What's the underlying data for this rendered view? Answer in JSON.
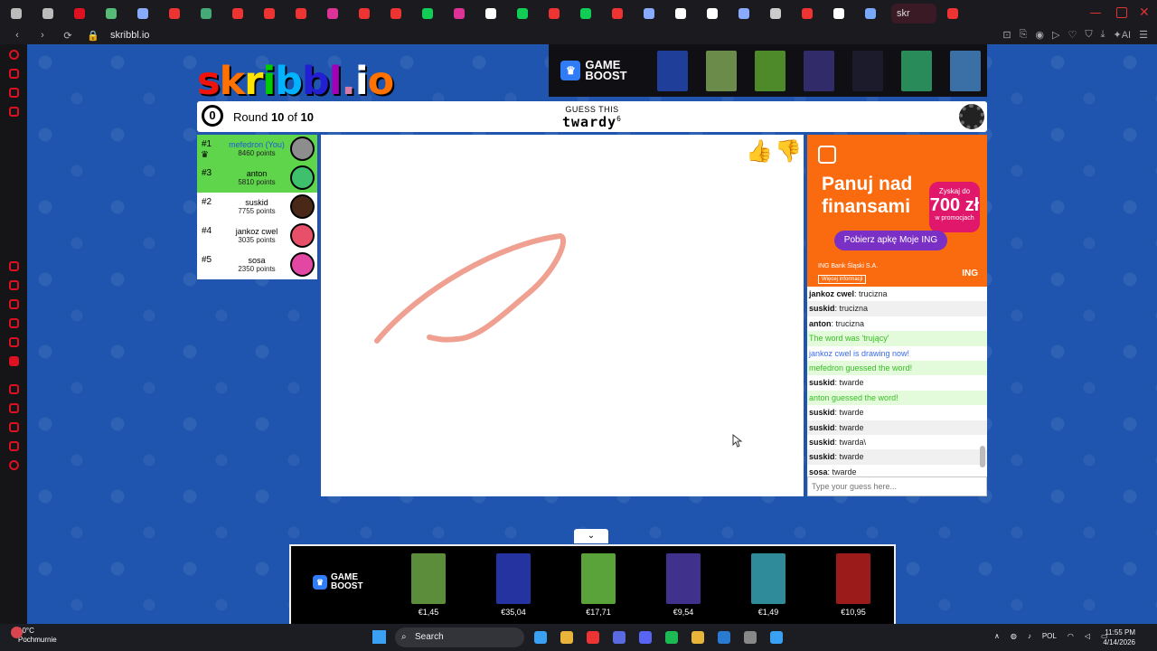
{
  "browser": {
    "url": "skribbl.io",
    "active_tab_label": "skr",
    "tab_icon_colors": [
      "#bbb",
      "#bbb",
      "#d12",
      "#5b7",
      "#8af",
      "#e33",
      "#4a7",
      "#e33",
      "#e33",
      "#e33",
      "#d39",
      "#e33",
      "#e33",
      "#1c5",
      "#d39",
      "#fff",
      "#1c5",
      "#e33",
      "#1c5",
      "#e33",
      "#8af",
      "#fff",
      "#fff",
      "#8af",
      "#ccc",
      "#e33",
      "#fff",
      "#7af",
      "#e33"
    ]
  },
  "site": {
    "logo": "skribbl.io",
    "round_label_prefix": "Round",
    "round_current": "10",
    "round_sep": "of",
    "round_total": "10",
    "timer": "0",
    "guess_label": "GUESS THIS",
    "word": "twardy",
    "word_len": "6"
  },
  "ad_strip": {
    "brand_l1": "GAME",
    "brand_l2": "BOOST",
    "thumbs": [
      "#1e3e9a",
      "#6b8b4a",
      "#4e8a2a",
      "#312b6a",
      "#1b1b2b",
      "#2a8b5a",
      "#3a70a5"
    ]
  },
  "players": [
    {
      "rank": "#1",
      "name": "mefedron (You)",
      "points": "8460 points",
      "green": true,
      "you": true,
      "avatar": "#8d8d8d",
      "crown": "♛"
    },
    {
      "rank": "#3",
      "name": "anton",
      "points": "5810 points",
      "green": true,
      "you": false,
      "avatar": "#3ec06c",
      "crown": ""
    },
    {
      "rank": "#2",
      "name": "suskid",
      "points": "7755 points",
      "green": false,
      "you": false,
      "avatar": "#4a2818",
      "crown": ""
    },
    {
      "rank": "#4",
      "name": "jankoz cwel",
      "points": "3035 points",
      "green": false,
      "you": false,
      "avatar": "#e8506a",
      "crown": ""
    },
    {
      "rank": "#5",
      "name": "sosa",
      "points": "2350 points",
      "green": false,
      "you": false,
      "avatar": "#e347a4",
      "crown": ""
    }
  ],
  "reactions": {
    "like": "👍",
    "dislike": "👎"
  },
  "side_ad": {
    "headline_l1": "Panuj nad",
    "headline_l2": "finansami",
    "badge_top": "Zyskaj do",
    "badge_amount": "700 zł",
    "badge_bottom": "w promocjach",
    "cta": "Pobierz apkę Moje ING",
    "small": "ING Bank Śląski S.A.",
    "info": "Więcej informacji",
    "brand": "ING"
  },
  "chat": [
    {
      "who": "jankoz cwel",
      "text": "trucizna",
      "kind": "normal"
    },
    {
      "who": "suskid",
      "text": "trucizna",
      "kind": "normal"
    },
    {
      "who": "anton",
      "text": "trucizna",
      "kind": "normal"
    },
    {
      "who": "",
      "text": "The word was 'trujący'",
      "kind": "green"
    },
    {
      "who": "",
      "text": "jankoz cwel is drawing now!",
      "kind": "blue"
    },
    {
      "who": "",
      "text": "mefedron guessed the word!",
      "kind": "green"
    },
    {
      "who": "suskid",
      "text": "twarde",
      "kind": "normal"
    },
    {
      "who": "",
      "text": "anton guessed the word!",
      "kind": "green"
    },
    {
      "who": "suskid",
      "text": "twarde",
      "kind": "normal"
    },
    {
      "who": "suskid",
      "text": "twarde",
      "kind": "normal"
    },
    {
      "who": "suskid",
      "text": "twarda\\",
      "kind": "normal"
    },
    {
      "who": "suskid",
      "text": "twarde",
      "kind": "normal"
    },
    {
      "who": "sosa",
      "text": "twarde",
      "kind": "normal"
    }
  ],
  "guess_placeholder": "Type your guess here...",
  "bottom_ad": {
    "brand_l1": "GAME",
    "brand_l2": "BOOST",
    "items": [
      {
        "price": "€1,45",
        "color": "#5b8d3a"
      },
      {
        "price": "€35,04",
        "color": "#2433a0"
      },
      {
        "price": "€17,71",
        "color": "#5aa33a"
      },
      {
        "price": "€9,54",
        "color": "#40318c"
      },
      {
        "price": "€1,49",
        "color": "#2f8a9a"
      },
      {
        "price": "€10,95",
        "color": "#9b1b1b"
      }
    ]
  },
  "taskbar": {
    "temp": "10°C",
    "condition": "Pochmurnie",
    "search": "Search",
    "lang": "POL",
    "time": "11:55 PM",
    "date": "4/14/2026",
    "icons": [
      "#3aa0f4",
      "#e8b43a",
      "#e33",
      "#5a6ae0",
      "#5865f2",
      "#1db954",
      "#e8b43a",
      "#2a7ad0",
      "#888",
      "#3aa0f4"
    ]
  }
}
